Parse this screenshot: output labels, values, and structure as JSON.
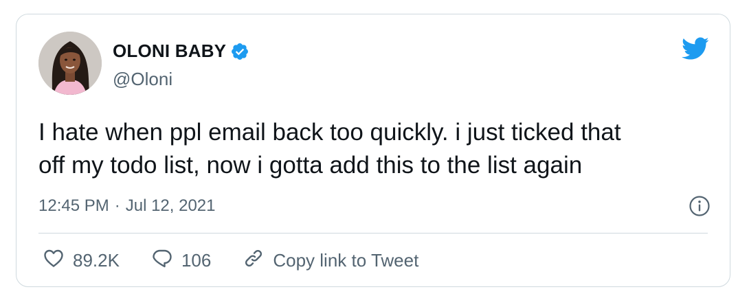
{
  "author": {
    "display_name": "OLONI BABY",
    "handle": "@Oloni",
    "verified": true
  },
  "tweet": {
    "text_lines": [
      "I hate when ppl email back too quickly. i just ticked that",
      "off my todo list, now i gotta add this to the list again"
    ],
    "time": "12:45 PM",
    "separator": "·",
    "date": "Jul 12, 2021"
  },
  "actions": {
    "likes": "89.2K",
    "replies": "106",
    "copy_link": "Copy link to Tweet"
  },
  "icons": {
    "brand": "twitter-bird-icon",
    "info": "info-icon",
    "like": "heart-icon",
    "reply": "comment-icon",
    "link": "link-icon",
    "verified": "verified-badge-icon"
  },
  "colors": {
    "brand_blue": "#1d9bf0",
    "text_primary": "#0f1419",
    "text_secondary": "#536471",
    "border": "#cfd9de"
  }
}
